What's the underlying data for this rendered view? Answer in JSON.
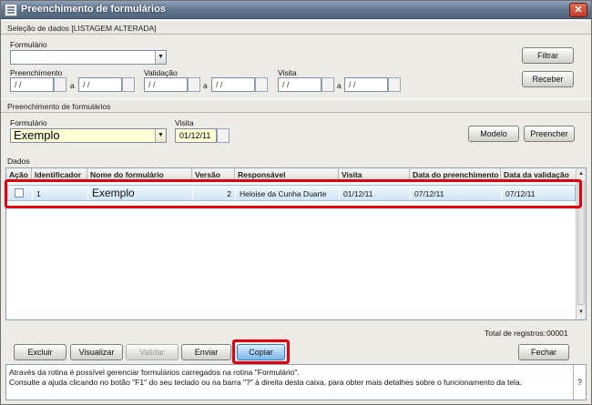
{
  "window": {
    "title": "Preenchimento de formulários",
    "close": "✕"
  },
  "selecao": {
    "header": "Seleção de dados [LISTAGEM ALTERADA]",
    "formulario_label": "Formulário",
    "formulario_value": "",
    "preenchimento_label": "Preenchimento",
    "validacao_label": "Validação",
    "visita_label": "Visita",
    "a": "a",
    "date_placeholder": " / /",
    "filtrar_label": "Filtrar",
    "receber_label": "Receber"
  },
  "preenchimento": {
    "header": "Preenchimento de formulários",
    "formulario_label": "Formulário",
    "formulario_value": "Exemplo",
    "visita_label": "Visita",
    "visita_value": "01/12/11",
    "modelo_label": "Modelo",
    "preencher_label": "Preencher"
  },
  "dados": {
    "header": "Dados",
    "columns": [
      "Ação",
      "Identificador",
      "Nome do formulário",
      "Versão",
      "Responsável",
      "Visita",
      "Data do preenchimento",
      "Data da validação"
    ],
    "rows": [
      {
        "acao": "",
        "identificador": "1",
        "nome": "Exemplo",
        "versao": "2",
        "responsavel": "Heloise da Cunha Duarte",
        "visita": "01/12/11",
        "data_preenchimento": "07/12/11",
        "data_validacao": "07/12/11"
      }
    ],
    "total_label": "Total de registros:",
    "total_value": "00001"
  },
  "buttons": {
    "excluir": "Excluir",
    "visualizar": "Visualizar",
    "validar": "Validar",
    "enviar": "Enviar",
    "copiar": "Copiar",
    "fechar": "Fechar"
  },
  "help": {
    "line1": "Através da rotina é possível gerenciar formulários carregados na rotina \"Formulário\".",
    "line2": "Consulte a ajuda clicando no botão \"F1\" do seu teclado ou na barra \"?\" à direita desta caixa, para obter mais detalhes sobre o funcionamento da tela.",
    "q": "?"
  },
  "colors": {
    "highlight": "#e5000f",
    "title_bar": "#5d738c",
    "selected_row": "#cfe3f4"
  }
}
